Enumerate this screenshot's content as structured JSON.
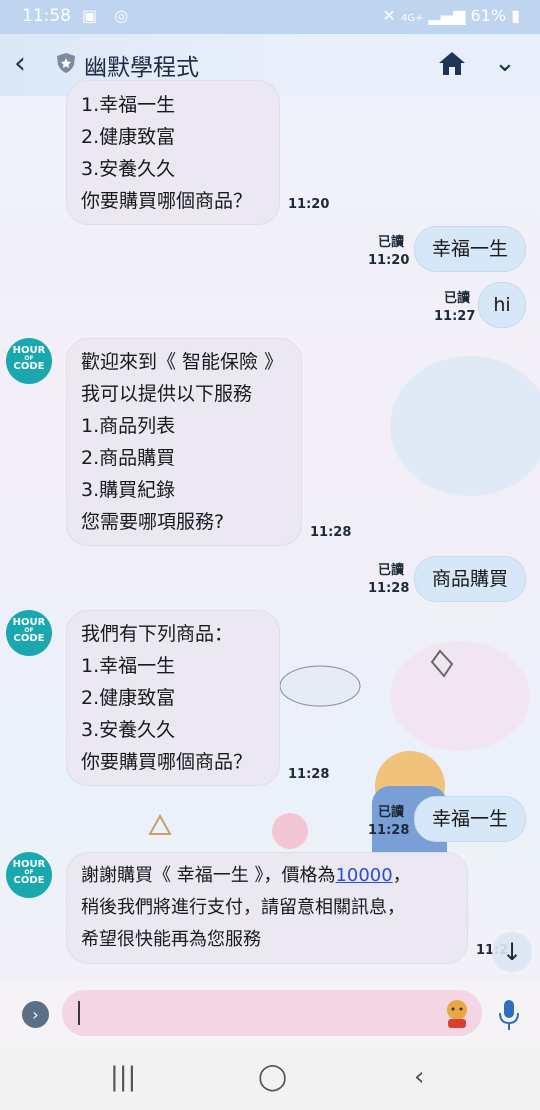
{
  "status_bar": {
    "time": "11:58",
    "signal": "4G+",
    "battery": "61%"
  },
  "header": {
    "title": "幽默學程式"
  },
  "avatar": {
    "line1": "HOUR",
    "line2": "OF",
    "line3": "CODE"
  },
  "messages": [
    {
      "side": "left",
      "text": "1.幸福一生\n2.健康致富\n3.安養久久\n你要購買哪個商品？",
      "time": "11:20"
    },
    {
      "side": "right",
      "text": "幸福一生",
      "read": "已讀",
      "time": "11:20"
    },
    {
      "side": "right",
      "text": "hi",
      "read": "已讀",
      "time": "11:27"
    },
    {
      "side": "left",
      "text": "歡迎來到《 智能保險 》\n我可以提供以下服務\n1.商品列表\n2.商品購買\n3.購買紀錄\n您需要哪項服務?",
      "time": "11:28"
    },
    {
      "side": "right",
      "text": "商品購買",
      "read": "已讀",
      "time": "11:28"
    },
    {
      "side": "left",
      "text": "我們有下列商品：\n1.幸福一生\n2.健康致富\n3.安養久久\n你要購買哪個商品？",
      "time": "11:28"
    },
    {
      "side": "right",
      "text": "幸福一生",
      "read": "已讀",
      "time": "11:28"
    },
    {
      "side": "left",
      "text_before": "謝謝購買《 幸福一生 》，價格為",
      "link": "10000",
      "text_after": "，\n稍後我們將進行支付，請留意相關訊息，\n希望很快能再為您服務",
      "time": "11:2"
    }
  ],
  "input": {
    "placeholder": ""
  },
  "colors": {
    "accent": "#1aa7b0",
    "left_bubble": "#ebe8f3",
    "right_bubble": "#d6e7f7",
    "link": "#2b4fd1"
  }
}
